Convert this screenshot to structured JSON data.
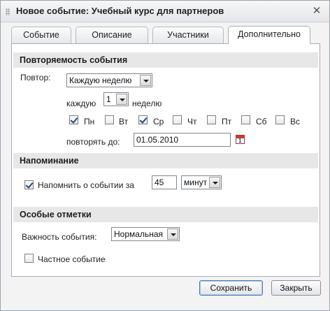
{
  "window": {
    "title": "Новое событие: Учебный курс для партнеров",
    "close_glyph": "✕"
  },
  "tabs": [
    {
      "label": "Событие",
      "active": false
    },
    {
      "label": "Описание",
      "active": false
    },
    {
      "label": "Участники",
      "active": false
    },
    {
      "label": "Дополнительно",
      "active": true
    }
  ],
  "recurrence": {
    "header": "Повторяемость события",
    "repeat_label": "Повтор:",
    "repeat_value": "Каждую неделю",
    "every_label": "каждую",
    "every_value": "1",
    "week_label": "неделю",
    "days": [
      {
        "label": "Пн",
        "checked": true
      },
      {
        "label": "Вт",
        "checked": false
      },
      {
        "label": "Ср",
        "checked": true
      },
      {
        "label": "Чт",
        "checked": false
      },
      {
        "label": "Пт",
        "checked": false
      },
      {
        "label": "Сб",
        "checked": false
      },
      {
        "label": "Вс",
        "checked": false
      }
    ],
    "until_label": "повторять до:",
    "until_value": "01.05.2010",
    "calendar_icon_day": "1"
  },
  "reminder": {
    "header": "Напоминание",
    "checked": true,
    "label": "Напомнить о событии за",
    "amount": "45",
    "unit": "минут"
  },
  "special": {
    "header": "Особые отметки",
    "importance_label": "Важность события:",
    "importance_value": "Нормальная",
    "private_label": "Частное событие",
    "private_checked": false
  },
  "buttons": {
    "save": "Сохранить",
    "close": "Закрыть"
  }
}
